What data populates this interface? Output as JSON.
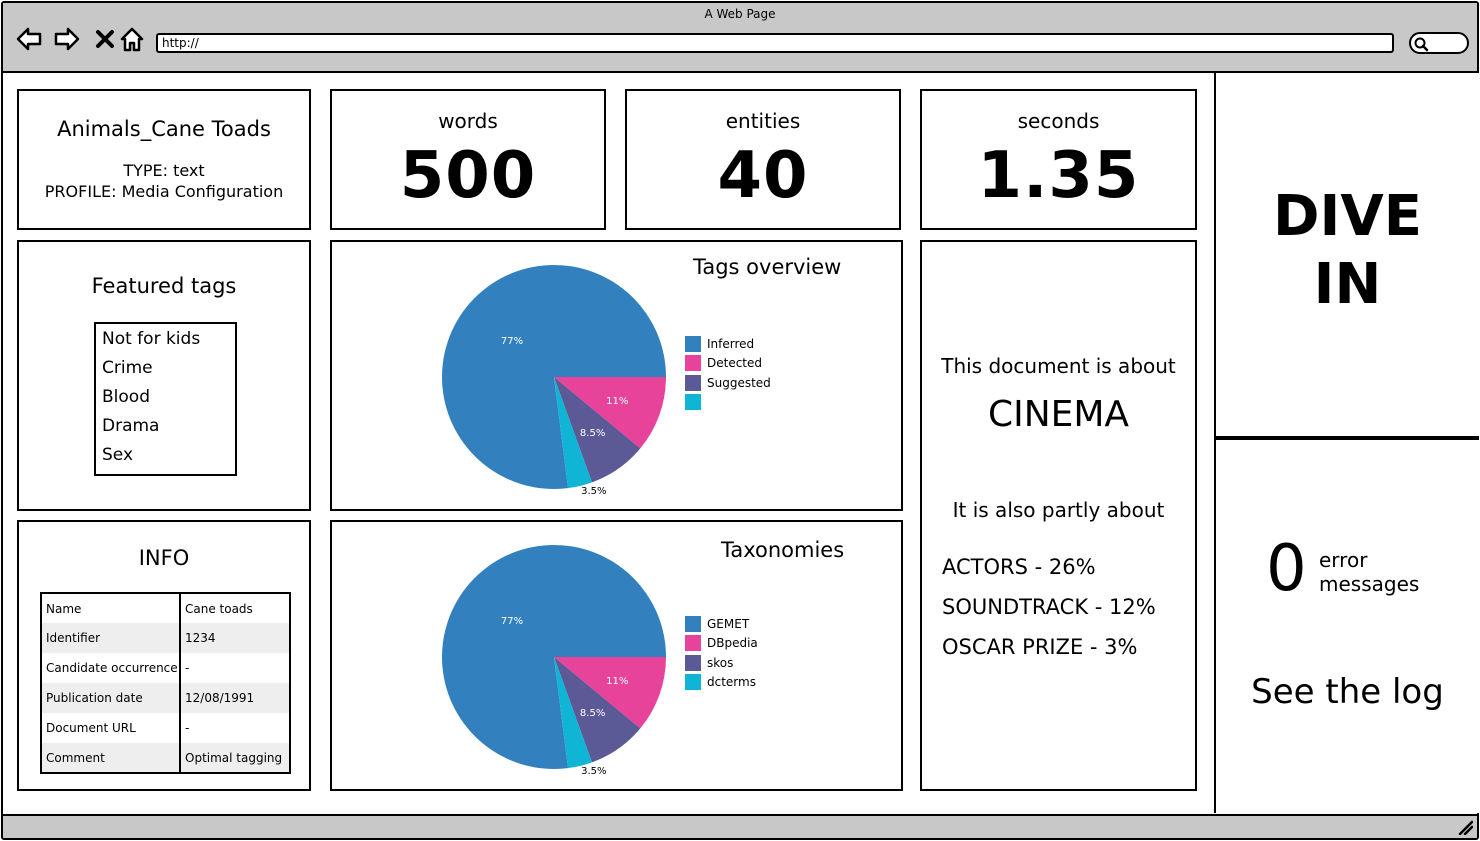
{
  "window": {
    "title": "A Web Page",
    "url": "http://"
  },
  "document": {
    "title": "Animals_Cane Toads",
    "type_line": "TYPE: text",
    "profile_line": "PROFILE: Media Configuration"
  },
  "stats": {
    "words": {
      "label": "words",
      "value": "500"
    },
    "entities": {
      "label": "entities",
      "value": "40"
    },
    "seconds": {
      "label": "seconds",
      "value": "1.35"
    }
  },
  "featured_tags": {
    "title": "Featured tags",
    "items": [
      "Not for kids",
      "Crime",
      "Blood",
      "Drama",
      "Sex"
    ]
  },
  "info": {
    "title": "INFO",
    "rows": [
      {
        "key": "Name",
        "value": "Cane toads"
      },
      {
        "key": "Identifier",
        "value": "1234"
      },
      {
        "key": "Candidate occurrence",
        "value": "-"
      },
      {
        "key": "Publication date",
        "value": "12/08/1991"
      },
      {
        "key": "Document URL",
        "value": "-"
      },
      {
        "key": "Comment",
        "value": "Optimal tagging"
      }
    ]
  },
  "about": {
    "intro": "This document is about",
    "main_topic": "CINEMA",
    "also": "It is also partly about",
    "topics": [
      "ACTORS - 26%",
      "SOUNDTRACK - 12%",
      "OSCAR PRIZE - 3%"
    ]
  },
  "dive_in": {
    "line1": "DIVE",
    "line2": "IN"
  },
  "errors": {
    "count": "0",
    "label_line1": "error",
    "label_line2": "messages",
    "link": "See the log"
  },
  "colors": {
    "blue": "#3380bf",
    "pink": "#e8439a",
    "purple": "#5b5a96",
    "cyan": "#10b5d6",
    "chrome": "#c8c8c8"
  },
  "chart_data": [
    {
      "type": "pie",
      "title": "Tags overview",
      "slices": [
        {
          "label": "Inferred",
          "value": 77,
          "text": "77%",
          "color": "#3380bf"
        },
        {
          "label": "Detected",
          "value": 11,
          "text": "11%",
          "color": "#e8439a"
        },
        {
          "label": "Suggested",
          "value": 8.5,
          "text": "8.5%",
          "color": "#5b5a96"
        },
        {
          "label": "",
          "value": 3.5,
          "text": "3.5%",
          "color": "#10b5d6"
        }
      ],
      "legend_position": "right"
    },
    {
      "type": "pie",
      "title": "Taxonomies",
      "slices": [
        {
          "label": "GEMET",
          "value": 77,
          "text": "77%",
          "color": "#3380bf"
        },
        {
          "label": "DBpedia",
          "value": 11,
          "text": "11%",
          "color": "#e8439a"
        },
        {
          "label": "skos",
          "value": 8.5,
          "text": "8.5%",
          "color": "#5b5a96"
        },
        {
          "label": "dcterms",
          "value": 3.5,
          "text": "3.5%",
          "color": "#10b5d6"
        }
      ],
      "legend_position": "right"
    }
  ]
}
